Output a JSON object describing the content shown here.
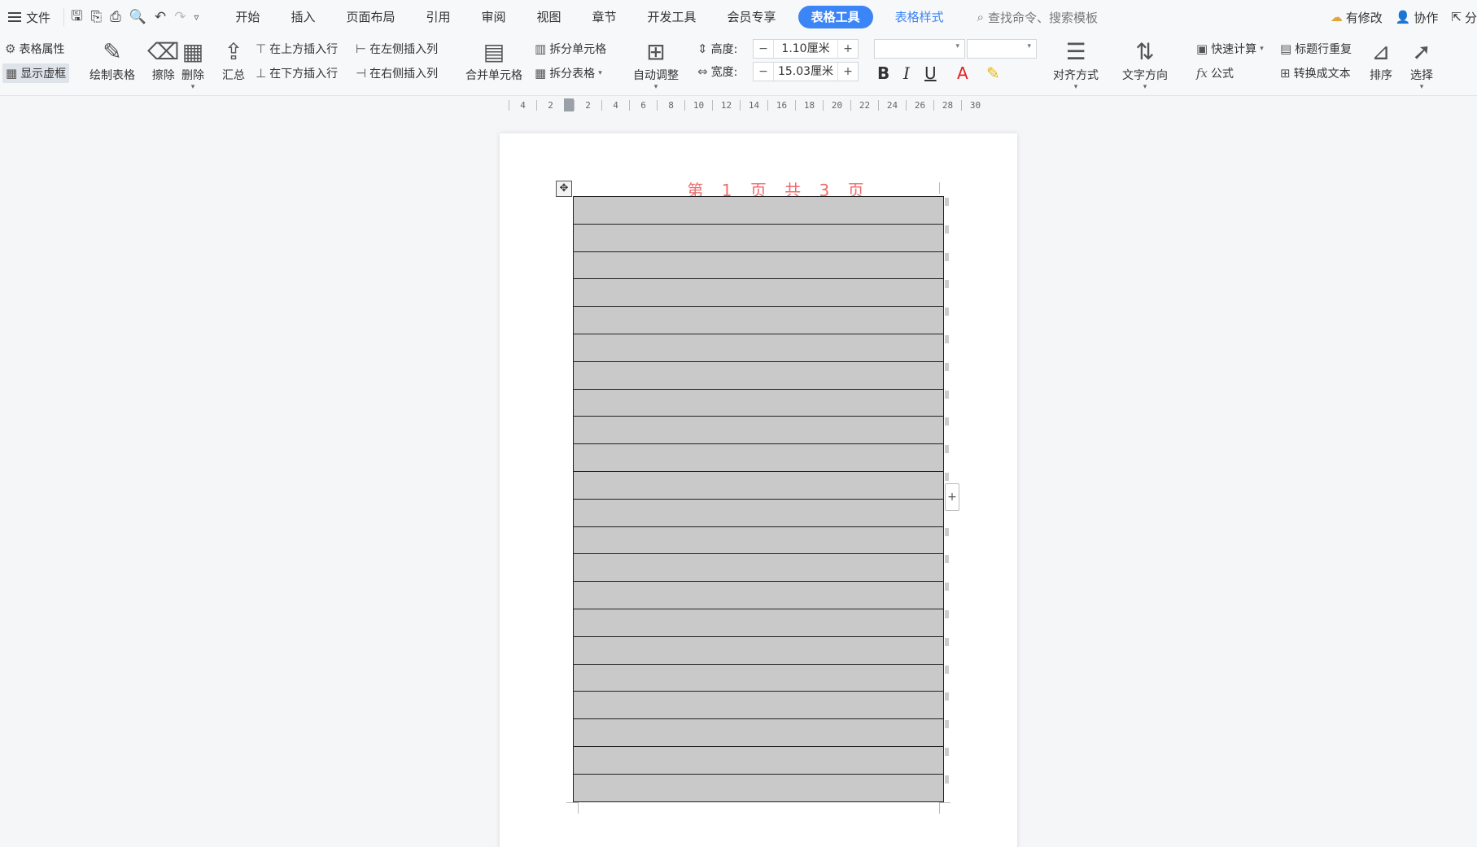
{
  "menubar": {
    "file_label": "文件",
    "tabs": [
      "开始",
      "插入",
      "页面布局",
      "引用",
      "审阅",
      "视图",
      "章节",
      "开发工具",
      "会员专享"
    ],
    "active_tab": "表格工具",
    "style_tab": "表格样式",
    "search_placeholder": "查找命令、搜索模板",
    "modify_label": "有修改",
    "collab_label": "协作",
    "share_label": "分"
  },
  "ribbon": {
    "table_props": "表格属性",
    "show_grid": "显示虚框",
    "draw_table": "绘制表格",
    "erase": "擦除",
    "delete": "删除",
    "summary": "汇总",
    "insert_above": "在上方插入行",
    "insert_below": "在下方插入行",
    "insert_left": "在左侧插入列",
    "insert_right": "在右侧插入列",
    "merge_cells": "合并单元格",
    "split_cells": "拆分单元格",
    "split_table": "拆分表格",
    "auto_fit": "自动调整",
    "height_label": "高度:",
    "height_value": "1.10厘米",
    "width_label": "宽度:",
    "width_value": "15.03厘米",
    "align": "对齐方式",
    "text_dir": "文字方向",
    "quick_calc": "快速计算",
    "formula": "公式",
    "header_repeat": "标题行重复",
    "to_text": "转换成文本",
    "sort": "排序",
    "select": "选择"
  },
  "ruler": {
    "labels": [
      "4",
      "2",
      "",
      "2",
      "4",
      "6",
      "8",
      "10",
      "12",
      "14",
      "16",
      "18",
      "20",
      "22",
      "24",
      "26",
      "28",
      "30"
    ]
  },
  "document": {
    "header_text": "第 1 页 共 3 页",
    "row_count": 22
  },
  "icons": {
    "search": "search-icon",
    "cloud": "cloud-icon",
    "user": "user-icon",
    "share": "share-icon"
  }
}
